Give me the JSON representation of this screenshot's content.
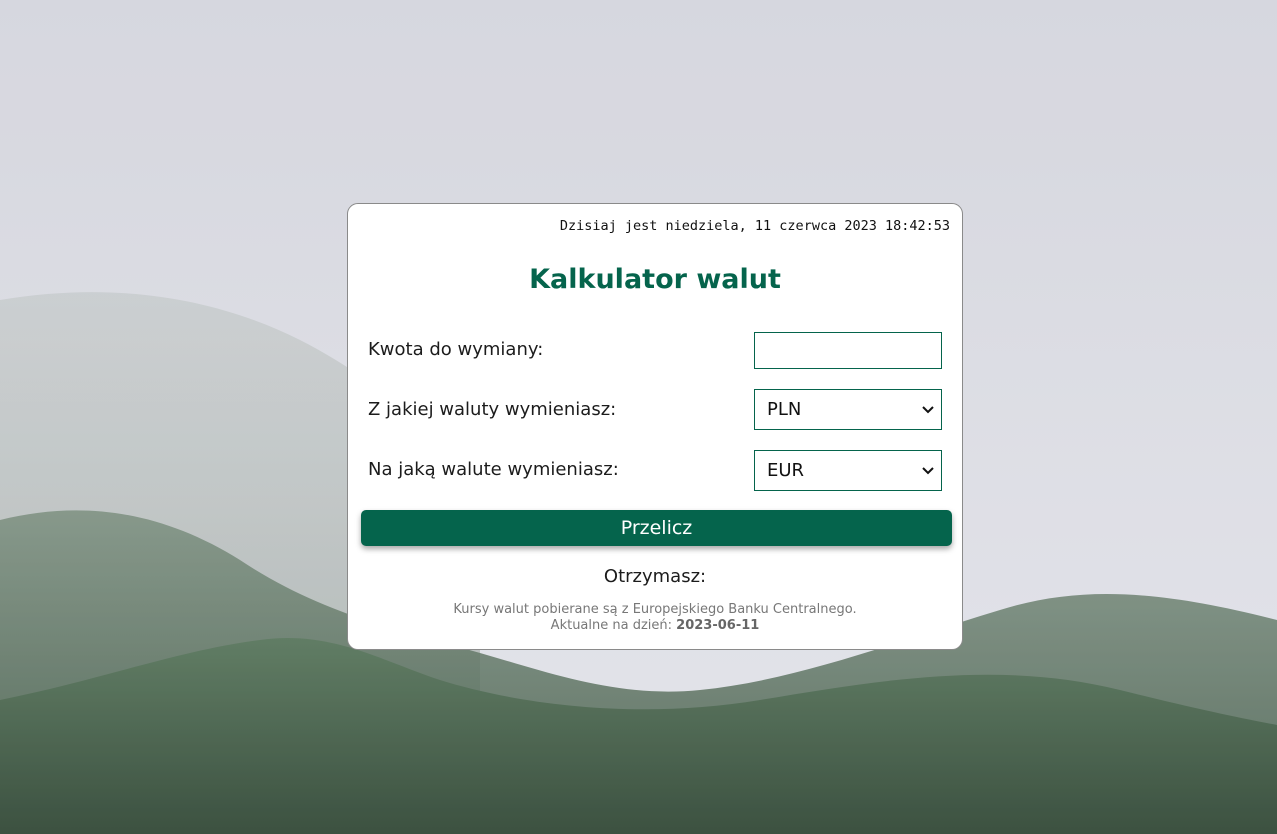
{
  "header": {
    "datetime": "Dzisiaj jest niedziela, 11 czerwca 2023 18:42:53"
  },
  "calculator": {
    "title": "Kalkulator walut",
    "amount_label": "Kwota do wymiany:",
    "amount_value": "",
    "from_label": "Z jakiej waluty wymieniasz:",
    "from_value": "PLN",
    "to_label": "Na jaką walute wymieniasz:",
    "to_value": "EUR",
    "submit_label": "Przelicz",
    "result_label": "Otrzymasz:",
    "source_note": "Kursy walut pobierane są z Europejskiego Banku Centralnego.",
    "date_prefix": "Aktualne na dzień:",
    "date_value": "2023-06-11"
  },
  "colors": {
    "accent": "#05644c",
    "card_background": "#ffffff"
  },
  "icons": {
    "select_arrow": "chevron-down-icon"
  }
}
